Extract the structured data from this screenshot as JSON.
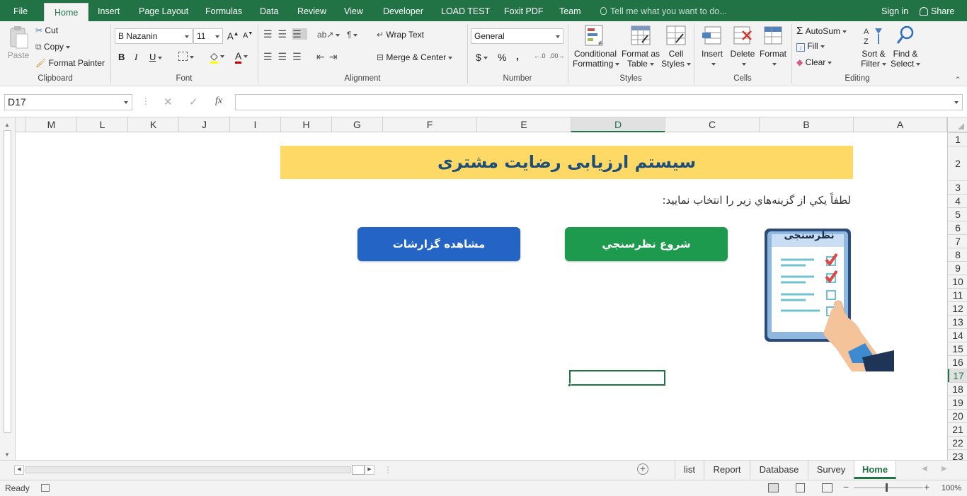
{
  "tabs": [
    "File",
    "Home",
    "Insert",
    "Page Layout",
    "Formulas",
    "Data",
    "Review",
    "View",
    "Developer",
    "LOAD TEST",
    "Foxit PDF",
    "Team"
  ],
  "tell_me": "Tell me what you want to do...",
  "sign_in": "Sign in",
  "share": "Share",
  "clipboard": {
    "paste": "Paste",
    "cut": "Cut",
    "copy": "Copy",
    "format_painter": "Format Painter",
    "label": "Clipboard"
  },
  "font": {
    "name": "B Nazanin",
    "size": "11",
    "label": "Font",
    "bold": "B",
    "italic": "I",
    "underline": "U"
  },
  "alignment": {
    "wrap": "Wrap Text",
    "merge": "Merge & Center",
    "label": "Alignment"
  },
  "number": {
    "format": "General",
    "currency": "$",
    "percent": "%",
    "comma": ",",
    "label": "Number"
  },
  "styles": {
    "conditional1": "Conditional",
    "conditional2": "Formatting",
    "format_table1": "Format as",
    "format_table2": "Table",
    "cell_styles1": "Cell",
    "cell_styles2": "Styles",
    "label": "Styles"
  },
  "cells": {
    "insert": "Insert",
    "delete": "Delete",
    "format": "Format",
    "label": "Cells"
  },
  "editing": {
    "autosum": "AutoSum",
    "fill": "Fill",
    "clear": "Clear",
    "sort1": "Sort &",
    "sort2": "Filter",
    "find1": "Find &",
    "find2": "Select",
    "label": "Editing"
  },
  "formula_bar": {
    "name_box": "D17",
    "fx": "fx",
    "value": ""
  },
  "columns": [
    "M",
    "L",
    "K",
    "J",
    "I",
    "H",
    "G",
    "F",
    "E",
    "D",
    "C",
    "B",
    "A"
  ],
  "rows": [
    "1",
    "2",
    "3",
    "4",
    "5",
    "6",
    "7",
    "8",
    "9",
    "10",
    "11",
    "12",
    "13",
    "14",
    "15",
    "16",
    "17",
    "18",
    "19",
    "20",
    "21",
    "22",
    "23"
  ],
  "selected": {
    "col": "D",
    "row": "17"
  },
  "sheet": {
    "title": "سیستم ارزیابی رضایت مشتری",
    "prompt": "لطفاً يكي از گزينه‌هاي زير را انتخاب نماييد:",
    "start_survey": "شروع نظرسنجي",
    "view_reports": "مشاهده گزارشات",
    "clipboard_image_title": "نظرسنجی",
    "title_bg": "#ffd966",
    "title_color": "#1f4e79",
    "btn_green": "#1e9a4e",
    "btn_blue": "#2464c4"
  },
  "sheet_tabs": [
    "list",
    "Report",
    "Database",
    "Survey",
    "Home"
  ],
  "active_sheet": "Home",
  "status": {
    "ready": "Ready",
    "zoom": "100%"
  }
}
